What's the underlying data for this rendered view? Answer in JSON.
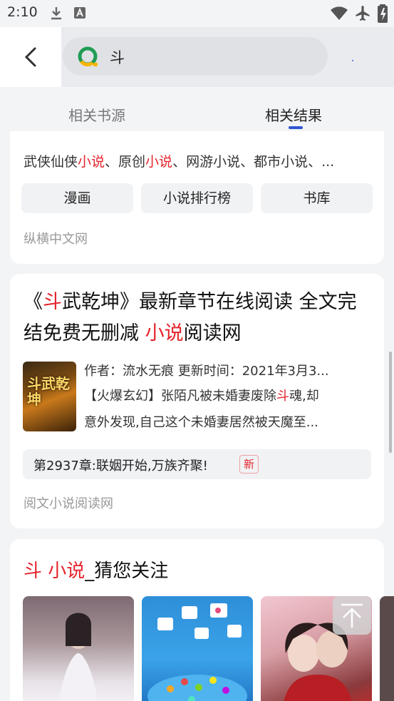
{
  "status_bar": {
    "time": "2:10"
  },
  "search": {
    "query": "斗"
  },
  "tabs": [
    {
      "label": "相关书源"
    },
    {
      "label": "相关结果"
    }
  ],
  "card1": {
    "keyword_parts": [
      "武侠仙侠",
      "小说",
      "、原创",
      "小说",
      "、网游小说、都市小说、..."
    ],
    "chips": [
      "漫画",
      "小说排行榜",
      "书库"
    ],
    "source": "纵横中文网"
  },
  "card2": {
    "title_part1": "《",
    "title_hl1": "斗",
    "title_part2": "武乾坤》最新章节在线阅读 全文完结免费无删减 ",
    "title_hl2": "小说",
    "title_part3": "阅读网",
    "cover_text": "斗武乾坤",
    "meta_line1": "作者：流水无痕  更新时间：2021年3月3...",
    "meta_line2_a": "【火爆玄幻】张陌凡被未婚妻废除",
    "meta_line2_hl": "斗",
    "meta_line2_b": "魂,却",
    "meta_line3": "意外发现,自己这个未婚妻居然被天魔至...",
    "chapter": "第2937章:联姻开始,万族齐聚!",
    "badge": "新",
    "source": "阅文小说阅读网"
  },
  "card3": {
    "title_hl": "斗 小说",
    "title_rest": "_猜您关注"
  }
}
